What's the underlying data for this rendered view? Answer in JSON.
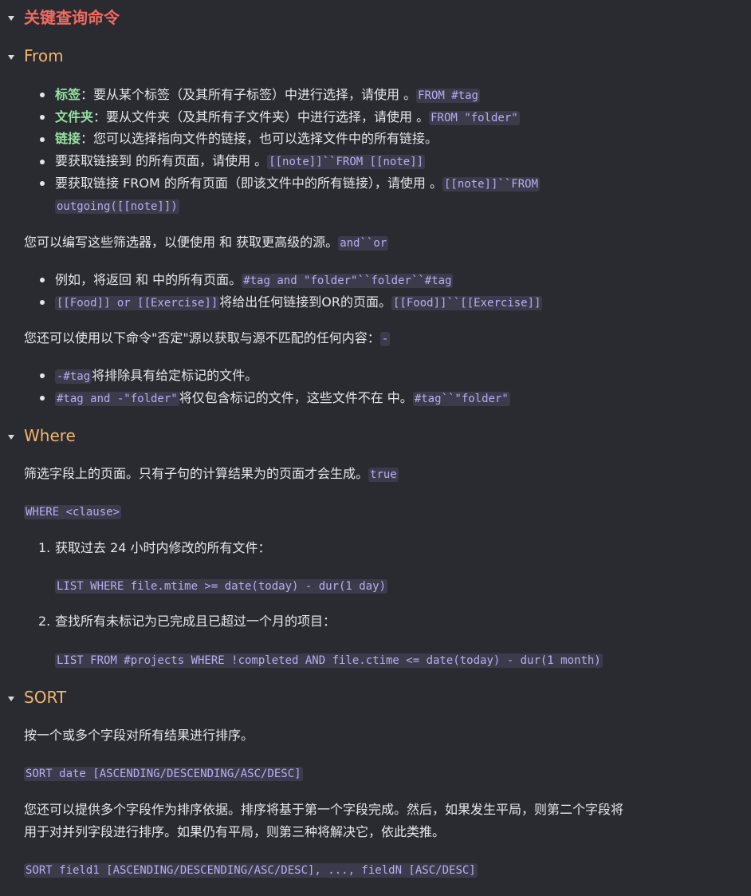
{
  "title": "关键查询命令",
  "from": {
    "heading": "From",
    "b1_term": "标签",
    "b1_text": "：要从某个标签（及其所有子标签）中进行选择，请使用 。",
    "b1_code": "FROM #tag",
    "b2_term": "文件夹",
    "b2_text": "：要从文件夹（及其所有子文件夹）中进行选择，请使用 。",
    "b2_code": "FROM \"folder\"",
    "b3_term": "链接",
    "b3_text": "：您可以选择指向文件的链接，也可以选择文件中的所有链接。",
    "b4_text": "要获取链接到 的所有页面，请使用 。",
    "b4_code": "[[note]]``FROM [[note]]",
    "b5_text": "要获取链接 FROM 的所有页面（即该文件中的所有链接），请使用 。",
    "b5_code1": "[[note]]``FROM",
    "b5_code2": "outgoing([[note]])",
    "para1_text": "您可以编写这些筛选器，以便使用 和 获取更高级的源。",
    "para1_code": "and``or",
    "c1_text": "例如，将返回 和 中的所有页面。",
    "c1_code": "#tag and \"folder\"``folder``#tag",
    "c2_code1": "[[Food]] or [[Exercise]]",
    "c2_text": "将给出任何链接到OR的页面。",
    "c2_code2": "[[Food]]``[[Exercise]]",
    "para2_text": "您还可以使用以下命令\"否定\"源以获取与源不匹配的任何内容：",
    "para2_code": "-",
    "d1_code": "-#tag",
    "d1_text": "将排除具有给定标记的文件。",
    "d2_code1": "#tag and -\"folder\"",
    "d2_text": "将仅包含标记的文件，这些文件不在 中。",
    "d2_code2": "#tag``\"folder\""
  },
  "where": {
    "heading": "Where",
    "para_text": "筛选字段上的页面。只有子句的计算结果为的页面才会生成。",
    "para_code": "true",
    "syntax": "WHERE <clause>",
    "n1_num": "1.",
    "n1_text": "获取过去 24 小时内修改的所有文件：",
    "n1_code": "LIST WHERE file.mtime >= date(today) - dur(1 day)",
    "n2_num": "2.",
    "n2_text": "查找所有未标记为已完成且已超过一个月的项目：",
    "n2_code": "LIST FROM #projects WHERE !completed AND file.ctime <= date(today) - dur(1 month)"
  },
  "sort": {
    "heading": "SORT",
    "para1": "按一个或多个字段对所有结果进行排序。",
    "syntax1": "SORT date [ASCENDING/DESCENDING/ASC/DESC]",
    "para2_line1": "您还可以提供多个字段作为排序依据。排序将基于第一个字段完成。然后，如果发生平局，则第二个字段将",
    "para2_line2": "用于对并列字段进行排序。如果仍有平局，则第三种将解决它，依此类推。",
    "syntax2": "SORT field1 [ASCENDING/DESCENDING/ASC/DESC], ..., fieldN [ASC/DESC]"
  },
  "colors": {
    "background": "#2a2a31",
    "title": "#ef6b61",
    "heading": "#f2b56b",
    "term": "#93e39f",
    "code_text": "#b8aeee",
    "code_bg": "#3c3b4c"
  },
  "icons": [
    "collapse-chevron-icon"
  ]
}
